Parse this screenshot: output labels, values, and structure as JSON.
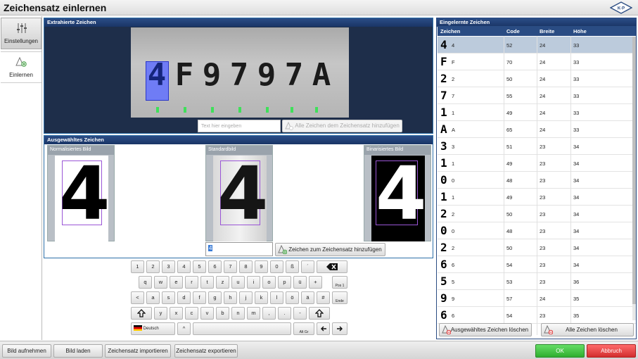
{
  "window": {
    "title": "Zeichensatz einlernen"
  },
  "nav": [
    {
      "label": "Einstellungen",
      "icon": "sliders-icon"
    },
    {
      "label": "Einlernen",
      "icon": "learn-triangle-icon"
    }
  ],
  "extracted": {
    "heading": "Extrahierte Zeichen",
    "plate_text": [
      "4",
      "F",
      "9",
      "7",
      "9",
      "7",
      "A"
    ],
    "input_placeholder": "Text hier eingeben",
    "add_all_label": "Alle Zeichen dem Zeichensatz hinzufügen"
  },
  "selected": {
    "heading": "Ausgewähltes Zeichen",
    "normalized_label": "Normalisiertes Bild",
    "standard_label": "Standardbild",
    "binarized_label": "Binarisiertes Bild",
    "char_value": "4",
    "add_char_label": "Zeichen zum Zeichensatz hinzufügen"
  },
  "keyboard": {
    "row1": [
      "1",
      "2",
      "3",
      "4",
      "5",
      "6",
      "7",
      "8",
      "9",
      "0",
      "ß",
      "´"
    ],
    "row2": [
      "q",
      "w",
      "e",
      "r",
      "t",
      "z",
      "u",
      "i",
      "o",
      "p",
      "ü",
      "+"
    ],
    "row2_extra": "Pos 1",
    "row3": [
      "<",
      "a",
      "s",
      "d",
      "f",
      "g",
      "h",
      "j",
      "k",
      "l",
      "ö",
      "ä",
      "#"
    ],
    "row3_extra": "Ende",
    "row4": [
      "y",
      "x",
      "c",
      "v",
      "b",
      "n",
      "m",
      ",",
      ".",
      "-"
    ],
    "lang": "Deutsch",
    "caret": "^",
    "altgr": "Alt Gr"
  },
  "learned": {
    "heading": "Eingelernte Zeichen",
    "columns": [
      "Zeichen",
      "Code",
      "Breite",
      "Höhe"
    ],
    "rows": [
      {
        "char": "4",
        "code": "52",
        "width": "24",
        "height": "33"
      },
      {
        "char": "F",
        "code": "70",
        "width": "24",
        "height": "33"
      },
      {
        "char": "2",
        "code": "50",
        "width": "24",
        "height": "33"
      },
      {
        "char": "7",
        "code": "55",
        "width": "24",
        "height": "33"
      },
      {
        "char": "1",
        "code": "49",
        "width": "24",
        "height": "33"
      },
      {
        "char": "A",
        "code": "65",
        "width": "24",
        "height": "33"
      },
      {
        "char": "3",
        "code": "51",
        "width": "23",
        "height": "34"
      },
      {
        "char": "1",
        "code": "49",
        "width": "23",
        "height": "34"
      },
      {
        "char": "0",
        "code": "48",
        "width": "23",
        "height": "34"
      },
      {
        "char": "1",
        "code": "49",
        "width": "23",
        "height": "34"
      },
      {
        "char": "2",
        "code": "50",
        "width": "23",
        "height": "34"
      },
      {
        "char": "0",
        "code": "48",
        "width": "23",
        "height": "34"
      },
      {
        "char": "2",
        "code": "50",
        "width": "23",
        "height": "34"
      },
      {
        "char": "6",
        "code": "54",
        "width": "23",
        "height": "34"
      },
      {
        "char": "5",
        "code": "53",
        "width": "23",
        "height": "36"
      },
      {
        "char": "9",
        "code": "57",
        "width": "24",
        "height": "35"
      },
      {
        "char": "6",
        "code": "54",
        "width": "23",
        "height": "35"
      }
    ],
    "delete_selected_label": "Ausgewähltes Zeichen löschen",
    "delete_all_label": "Alle Zeichen löschen"
  },
  "footer": {
    "capture": "Bild aufnehmen",
    "load": "Bild laden",
    "import": "Zeichensatz importieren",
    "export": "Zeichensatz exportieren",
    "ok": "OK",
    "cancel": "Abbruch"
  },
  "colors": {
    "header_blue": "#1f3c70",
    "ok_green": "#3cbf3c",
    "cancel_red": "#e04040",
    "highlight": "#5a6df0"
  }
}
